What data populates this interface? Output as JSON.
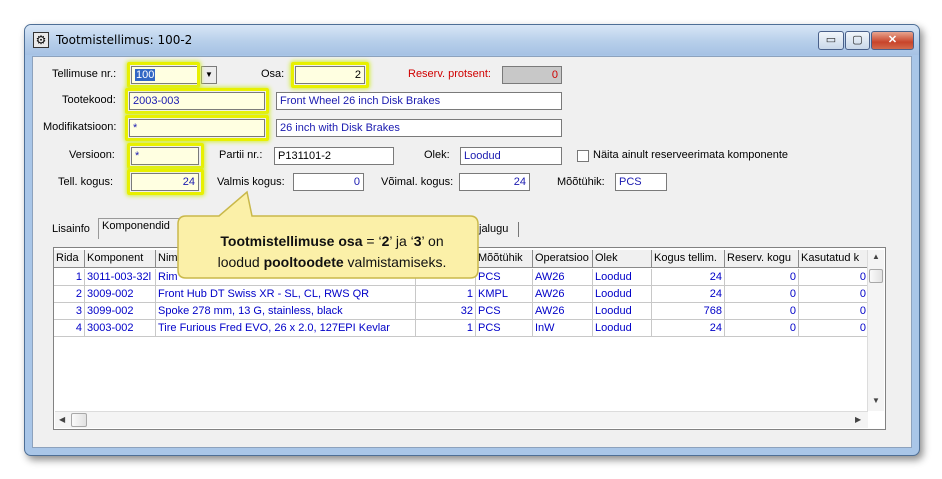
{
  "window": {
    "title": "Tootmistellimus: 100-2",
    "minimize_glyph": "▭",
    "maximize_glyph": "▢",
    "close_glyph": "✕",
    "icon": "gear-icon"
  },
  "form": {
    "order_no_label": "Tellimuse nr.:",
    "order_no_value": "100",
    "part_label": "Osa:",
    "part_value": "2",
    "reserve_pct_label": "Reserv. protsent:",
    "reserve_pct_value": "0",
    "product_code_label": "Tootekood:",
    "product_code_value": "2003-003",
    "product_name": "Front Wheel 26 inch Disk Brakes",
    "modification_label": "Modifikatsioon:",
    "modification_value": "*",
    "modification_name": "26 inch with Disk Brakes",
    "version_label": "Versioon:",
    "version_value": "*",
    "batch_label": "Partii nr.:",
    "batch_value": "P131101-2",
    "status_label": "Olek:",
    "status_value": "Loodud",
    "show_unreserved_label": "Näita ainult reserveerimata komponente",
    "show_unreserved_checked": false,
    "ordered_qty_label": "Tell. kogus:",
    "ordered_qty_value": "24",
    "finished_qty_label": "Valmis kogus:",
    "finished_qty_value": "0",
    "possible_qty_label": "Võimal. kogus:",
    "possible_qty_value": "24",
    "unit_label": "Mõõtühik:",
    "unit_value": "PCS"
  },
  "tabs": [
    {
      "label": "Lisainfo"
    },
    {
      "label": "Komponendid"
    },
    {
      "label": "jalugu"
    }
  ],
  "callout": {
    "line1_bold": "Tootmistellimuse osa",
    "line1_mid": " = ‘",
    "val1": "2",
    "line1_mid2": "’ ja ‘",
    "val2": "3",
    "line1_end": "’ on",
    "line2_start": "loodud ",
    "line2_bold": "pooltoodete",
    "line2_end": " valmistamiseks."
  },
  "grid": {
    "headers": [
      "Rida",
      "Komponent",
      "Nim",
      "",
      "Mõõtühik",
      "Operatsioo",
      "Olek",
      "Kogus tellim.",
      "Reserv. kogu",
      "Kasutatud k"
    ],
    "rows": [
      {
        "rida": "1",
        "komponent": "3011-003-32l",
        "nimetus": "Rim",
        "kogus": "",
        "yhik": "PCS",
        "operatsioon": "AW26",
        "olek": "Loodud",
        "kogus_tellim": "24",
        "reserv": "0",
        "kasutatud": "0"
      },
      {
        "rida": "2",
        "komponent": "3009-002",
        "nimetus": "Front Hub DT Swiss XR - SL, CL, RWS QR",
        "kogus": "1",
        "yhik": "KMPL",
        "operatsioon": "AW26",
        "olek": "Loodud",
        "kogus_tellim": "24",
        "reserv": "0",
        "kasutatud": "0"
      },
      {
        "rida": "3",
        "komponent": "3099-002",
        "nimetus": "Spoke 278 mm, 13 G, stainless, black",
        "kogus": "32",
        "yhik": "PCS",
        "operatsioon": "AW26",
        "olek": "Loodud",
        "kogus_tellim": "768",
        "reserv": "0",
        "kasutatud": "0"
      },
      {
        "rida": "4",
        "komponent": "3003-002",
        "nimetus": "Tire Furious Fred EVO, 26 x 2.0, 127EPI Kevlar",
        "kogus": "1",
        "yhik": "PCS",
        "operatsioon": "InW",
        "olek": "Loodud",
        "kogus_tellim": "24",
        "reserv": "0",
        "kasutatud": "0"
      }
    ]
  },
  "colors": {
    "highlight": "#e8f000",
    "callout_fill": "#fbf0a8",
    "data_text": "#0000c8",
    "label_red": "#d00000"
  }
}
